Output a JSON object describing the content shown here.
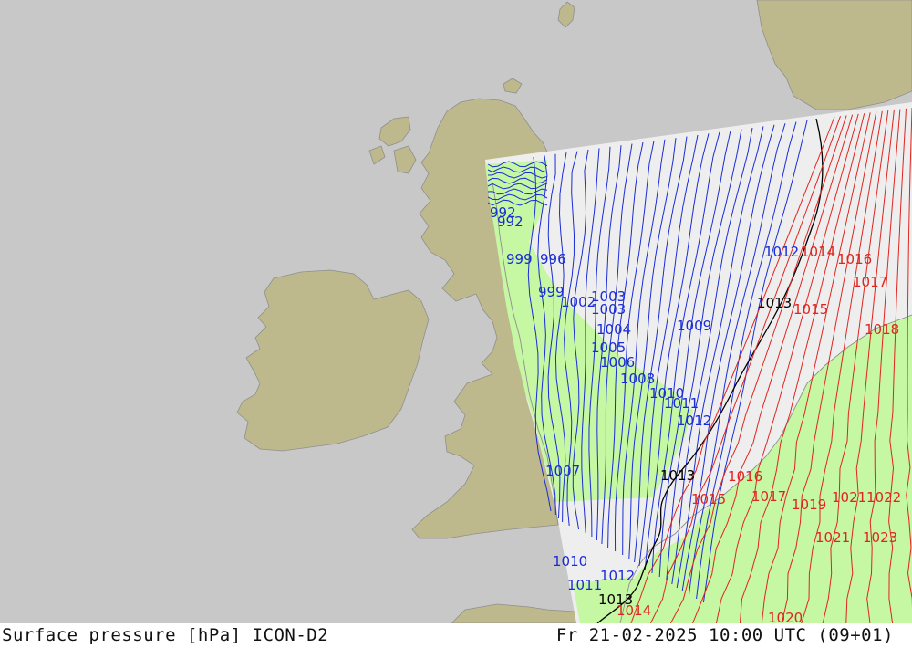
{
  "footer": {
    "left_title": "Surface pressure [hPa] ICON-D2",
    "right_time": "Fr 21-02-2025 10:00 UTC (09+01)"
  },
  "colors": {
    "background": "#c8c8c8",
    "land": "#bdb98c",
    "domain": "#eeeeee",
    "precip": "#c6f7a3",
    "low_isobar": "#1a2cd6",
    "mid_isobar": "#000000",
    "high_isobar": "#e0241f"
  },
  "isobar_labels": {
    "blue": [
      "992",
      "992",
      "996",
      "999",
      "999",
      "1002",
      "1003",
      "1003",
      "1004",
      "1005",
      "1006",
      "1008",
      "1009",
      "1010",
      "1011",
      "1012",
      "1007",
      "1010",
      "1011",
      "1012",
      "1012"
    ],
    "black": [
      "1013",
      "1013",
      "1013"
    ],
    "red": [
      "1014",
      "1016",
      "1017",
      "1018",
      "1015",
      "1016",
      "1015",
      "1017",
      "1019",
      "1021",
      "1022",
      "1021",
      "1023",
      "1014",
      "1020"
    ]
  },
  "isobar_label_style": {
    "low": "blue",
    "threshold": "1013",
    "high": "red"
  }
}
